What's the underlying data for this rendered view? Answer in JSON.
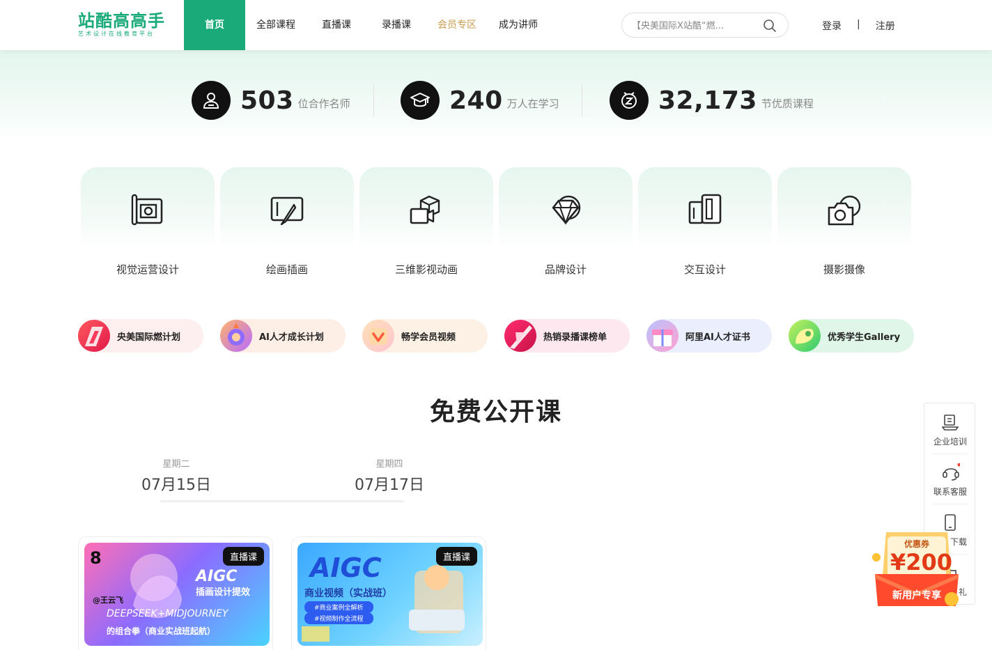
{
  "header": {
    "logo_main": "站酷高高手",
    "logo_sub": "艺术设计在线教育平台",
    "nav": [
      "首页",
      "全部课程",
      "直播课",
      "录播课",
      "会员专区",
      "成为讲师"
    ],
    "search_placeholder": "【央美国际X站酷“燃...",
    "login": "登录",
    "separator": "|",
    "register": "注册"
  },
  "stats": [
    {
      "num": "503",
      "unit": "位合作名师",
      "icon": "teacher-icon"
    },
    {
      "num": "240",
      "unit": "万人在学习",
      "icon": "graduation-cap-icon"
    },
    {
      "num": "32,173",
      "unit": "节优质课程",
      "icon": "z-coin-icon"
    }
  ],
  "categories": [
    {
      "label": "视觉运营设计",
      "icon": "canvas-brush-icon"
    },
    {
      "label": "绘画插画",
      "icon": "drawing-tablet-icon"
    },
    {
      "label": "三维影视动画",
      "icon": "3d-camera-icon"
    },
    {
      "label": "品牌设计",
      "icon": "diamond-icon"
    },
    {
      "label": "交互设计",
      "icon": "devices-icon"
    },
    {
      "label": "摄影摄像",
      "icon": "camera-icon"
    }
  ],
  "plans": [
    {
      "label": "央美国际燃计划",
      "bg": "#fdeef0"
    },
    {
      "label": "AI人才成长计划",
      "bg": "#fdeee6"
    },
    {
      "label": "畅学会员视频",
      "bg": "#fdf1e6"
    },
    {
      "label": "热销录播课榜单",
      "bg": "#fde8ef"
    },
    {
      "label": "阿里AI人才证书",
      "bg": "#ebeefd"
    },
    {
      "label": "优秀学生Gallery",
      "bg": "#dff6e9"
    }
  ],
  "section": {
    "title": "免费公开课",
    "dates": [
      {
        "weekday": "星期二",
        "day": "07月15日"
      },
      {
        "weekday": "星期四",
        "day": "07月17日"
      }
    ]
  },
  "courses": [
    {
      "badge": "直播课",
      "thumb_title": "AIGC",
      "thumb_sub": "插画设计提效",
      "thumb_line": "DEEPSEEK+MIDJOURNEY",
      "thumb_bottom": "的组合拳（商业实战班起航）",
      "teacher": "@王云飞",
      "num": "8"
    },
    {
      "badge": "直播课",
      "thumb_title": "AIGC",
      "thumb_sub": "商业视频（实战班）",
      "tag1": "#商业案例全解析",
      "tag2": "#视频制作全流程"
    }
  ],
  "side": [
    {
      "label": "企业培训",
      "icon": "enterprise-icon"
    },
    {
      "label": "联系客服",
      "icon": "customer-service-icon"
    },
    {
      "label": "下载",
      "icon": "phone-icon"
    },
    {
      "label": "礼",
      "icon": "gift-icon"
    }
  ],
  "coupon": {
    "title": "优惠券",
    "amount": "¥200",
    "note": "新用户专享"
  },
  "colors": {
    "brand": "#1aaa7a",
    "vip": "#c89b4e"
  }
}
